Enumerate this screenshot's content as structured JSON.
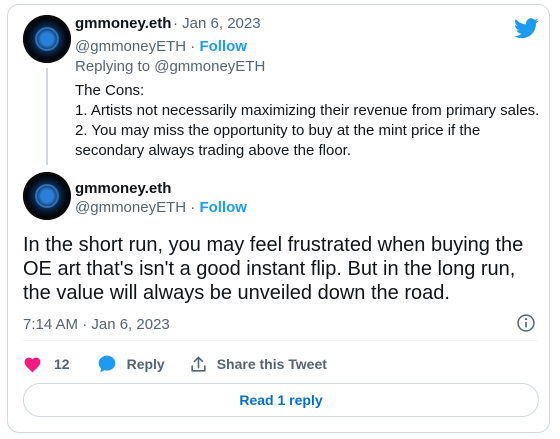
{
  "tweet_parent": {
    "name": "gmmoney.eth",
    "date": "· Jan 6, 2023",
    "handle": "@gmmoneyETH",
    "separator": "·",
    "follow_label": "Follow",
    "replying_to": "Replying to @gmmoneyETH",
    "body_lines": [
      "The Cons:",
      "1. Artists not necessarily maximizing their revenue from primary sales.",
      "2. You may miss the opportunity to buy at the mint price if the",
      "secondary always trading above the floor."
    ]
  },
  "tweet_main": {
    "name": "gmmoney.eth",
    "handle": "@gmmoneyETH",
    "separator": "·",
    "follow_label": "Follow",
    "text_lines": [
      "In the short run, you may feel frustrated when buying the",
      "OE art that's isn't a good instant flip. But in the long run,",
      "the value will always be unveiled down the road."
    ],
    "timestamp": "7:14 AM · Jan 6, 2023",
    "like_count": "12",
    "reply_label": "Reply",
    "share_label": "Share this Tweet",
    "read_replies_label": "Read 1 reply"
  },
  "icons": {
    "brand": "twitter-bird-icon",
    "info": "info-icon",
    "like": "heart-icon",
    "reply": "speech-bubble-icon",
    "share": "share-upload-icon"
  },
  "colors": {
    "twitter_blue": "#1d9bf0",
    "link_blue": "#006fd6",
    "like_pink": "#f91880",
    "text_primary": "#0f1419",
    "text_secondary": "#536471",
    "border": "#cfd9de"
  }
}
